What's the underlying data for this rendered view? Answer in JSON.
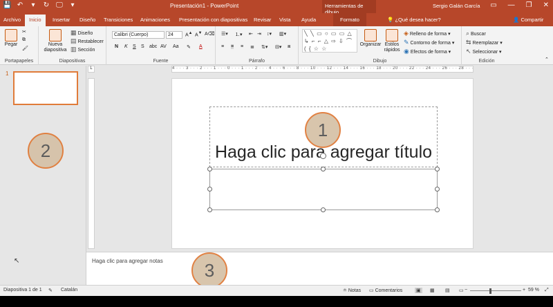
{
  "window": {
    "title": "Presentación1  -  PowerPoint",
    "contextual_group": "Herramientas de dibujo",
    "user": "Sergio Galán García",
    "qat": [
      "💾",
      "↶",
      "▾",
      "↻",
      "🖵",
      "▾"
    ],
    "controls": [
      "▭",
      "—",
      "❐",
      "✕"
    ]
  },
  "tabs": {
    "items": [
      "Archivo",
      "Inicio",
      "Insertar",
      "Diseño",
      "Transiciones",
      "Animaciones",
      "Presentación con diapositivas",
      "Revisar",
      "Vista",
      "Ayuda"
    ],
    "format": "Formato",
    "help": "¿Qué desea hacer?",
    "share": "Compartir"
  },
  "ribbon": {
    "groups": {
      "clipboard": "Portapapeles",
      "slides": "Diapositivas",
      "font": "Fuente",
      "paragraph": "Párrafo",
      "drawing": "Dibujo",
      "editing": "Edición"
    },
    "paste": "Pegar",
    "new_slide": "Nueva diapositiva",
    "layout": "Diseño",
    "reset": "Restablecer",
    "section": "Sección",
    "font_name": "Calibri (Cuerpo)",
    "font_size": "24",
    "font_styles": [
      "N",
      "K",
      "S",
      "S",
      "AV",
      "Aa",
      "A"
    ],
    "shapes_glyphs": "╲ ╲ ▭ ○ ▭ ▭ △ ↳ ⌐ ⌐ △ ⇨ ⇩ ⌒ ( { ☆ ☆",
    "arrange": "Organizar",
    "quick_styles": "Estilos rápidos",
    "shape_fill": "Relleno de forma",
    "shape_outline": "Contorno de forma",
    "shape_effects": "Efectos de forma",
    "find": "Buscar",
    "replace": "Reemplazar",
    "select": "Seleccionar"
  },
  "ruler": {
    "h_labels": "4 · · · 3 · · · 2 · · · 1 · · · 0 · · · 1 · · · 2 · · · 4 · · · 6 · · · 8 · · · 10 · · · 12 · · · 14 · · · 16 · · · 18 · · · 20 · · · 22 · · · 24 · · · 26 · · · 28 · · · 30"
  },
  "thumbs": {
    "number": "1"
  },
  "slide": {
    "title_placeholder": "Haga clic para agregar título"
  },
  "notes": {
    "placeholder": "Haga clic para agregar notas"
  },
  "callouts": [
    "1",
    "2",
    "3"
  ],
  "status": {
    "slide_info": "Diapositiva 1 de 1",
    "language": "Catalán",
    "notes": "Notas",
    "comments": "Comentarios",
    "zoom": "59 %"
  }
}
